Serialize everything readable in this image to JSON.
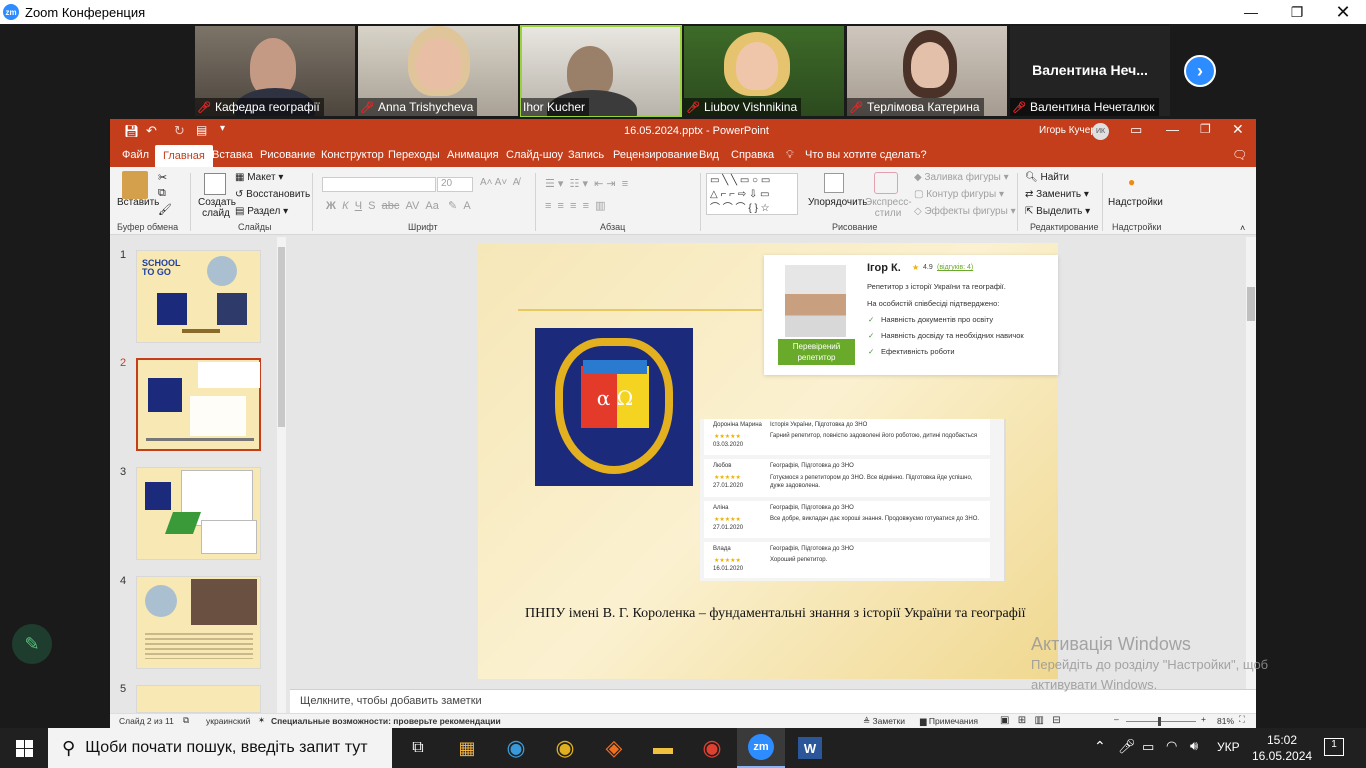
{
  "zoom": {
    "title": "Zoom Конференция",
    "participants": [
      {
        "name": "Кафедра географії"
      },
      {
        "name": "Anna Trishycheva"
      },
      {
        "name": "Ihor Kucher"
      },
      {
        "name": "Liubov Vishnikina"
      },
      {
        "name": "Терлімова Катерина"
      },
      {
        "name": "Валентина Нечеталюк",
        "tile_text": "Валентина  Неч..."
      }
    ]
  },
  "powerpoint": {
    "file_title": "16.05.2024.pptx  -  PowerPoint",
    "user": "Игорь Кучер",
    "user_initials": "ИК",
    "tabs": [
      "Файл",
      "Главная",
      "Вставка",
      "Рисование",
      "Конструктор",
      "Переходы",
      "Анимация",
      "Слайд-шоу",
      "Запись",
      "Рецензирование",
      "Вид",
      "Справка"
    ],
    "tell_me": "Что вы хотите сделать?",
    "ribbon": {
      "paste": "Вставить",
      "clipboard_group": "Буфер обмена",
      "new_slide": "Создать слайд",
      "layout": "Макет",
      "reset": "Восстановить",
      "section": "Раздел",
      "slides_group": "Слайды",
      "font_size": "20",
      "font_group": "Шрифт",
      "paragraph_group": "Абзац",
      "arrange": "Упорядочить",
      "quick_styles": "Экспресс-стили",
      "shape_fill": "Заливка фигуры",
      "shape_outline": "Контур фигуры",
      "shape_effects": "Эффекты фигуры",
      "drawing_group": "Рисование",
      "find": "Найти",
      "replace": "Заменить",
      "select": "Выделить",
      "editing_group": "Редактирование",
      "addins": "Надстройки",
      "addins_group": "Надстройки"
    },
    "thumbnail_numbers": [
      "1",
      "2",
      "3",
      "4",
      "5"
    ],
    "thumb1": {
      "title": "SCHOOL TO GO"
    },
    "slide": {
      "caption": "ПНПУ імені В. Г. Короленка – фундаментальні знання з історії України та географії",
      "emblem_letters": "α Ω",
      "tutor": {
        "name": "Ігор К.",
        "rating": "4.9",
        "reviews_link": "(відгуків: 4)",
        "subject": "Репетитор з історії України та географії.",
        "verified_intro": "На особистій співбесіді підтверджено:",
        "checks": [
          "Наявність документів про освіту",
          "Наявність досвіду та необхідних навичок",
          "Ефективність роботи"
        ],
        "badge": "Перевірений репетитор"
      },
      "reviews": [
        {
          "author": "Дороніна Марина",
          "date": "03.03.2020",
          "subject": "Історія України, Підготовка до ЗНО",
          "text": "Гарний репетитор, повністю задоволені його роботою, дитині подобається"
        },
        {
          "author": "Любов",
          "date": "27.01.2020",
          "subject": "Географія, Підготовка до ЗНО",
          "text": "Готуємося з репетитором до ЗНО. Все відмінно. Підготовка йде успішно, дуже задоволена."
        },
        {
          "author": "Аліна",
          "date": "27.01.2020",
          "subject": "Географія, Підготовка до ЗНО",
          "text": "Все добре, викладач дає хороші знання. Продовжуємо готуватися до ЗНО."
        },
        {
          "author": "Влада",
          "date": "16.01.2020",
          "subject": "Географія, Підготовка до ЗНО",
          "text": "Хороший репетитор."
        }
      ]
    },
    "notes_placeholder": "Щелкните, чтобы добавить заметки",
    "status": {
      "slide_count": "Слайд 2 из 11",
      "language": "украинский",
      "accessibility": "Специальные возможности: проверьте рекомендации",
      "notes": "Заметки",
      "comments": "Примечания",
      "zoom": "81%"
    }
  },
  "watermark": {
    "line1": "Активація Windows",
    "line2": "Перейдіть до розділу \"Настройки\", щоб",
    "line3": "активувати Windows."
  },
  "taskbar": {
    "search_placeholder": "Щоби почати пошук, введіть запит тут",
    "language": "УКР",
    "time": "15:02",
    "date": "16.05.2024",
    "notification_count": "1"
  },
  "colors": {
    "powerpoint_accent": "#c43e1c",
    "zoom_blue": "#2d8cff",
    "verified_green": "#6aaa2a"
  }
}
